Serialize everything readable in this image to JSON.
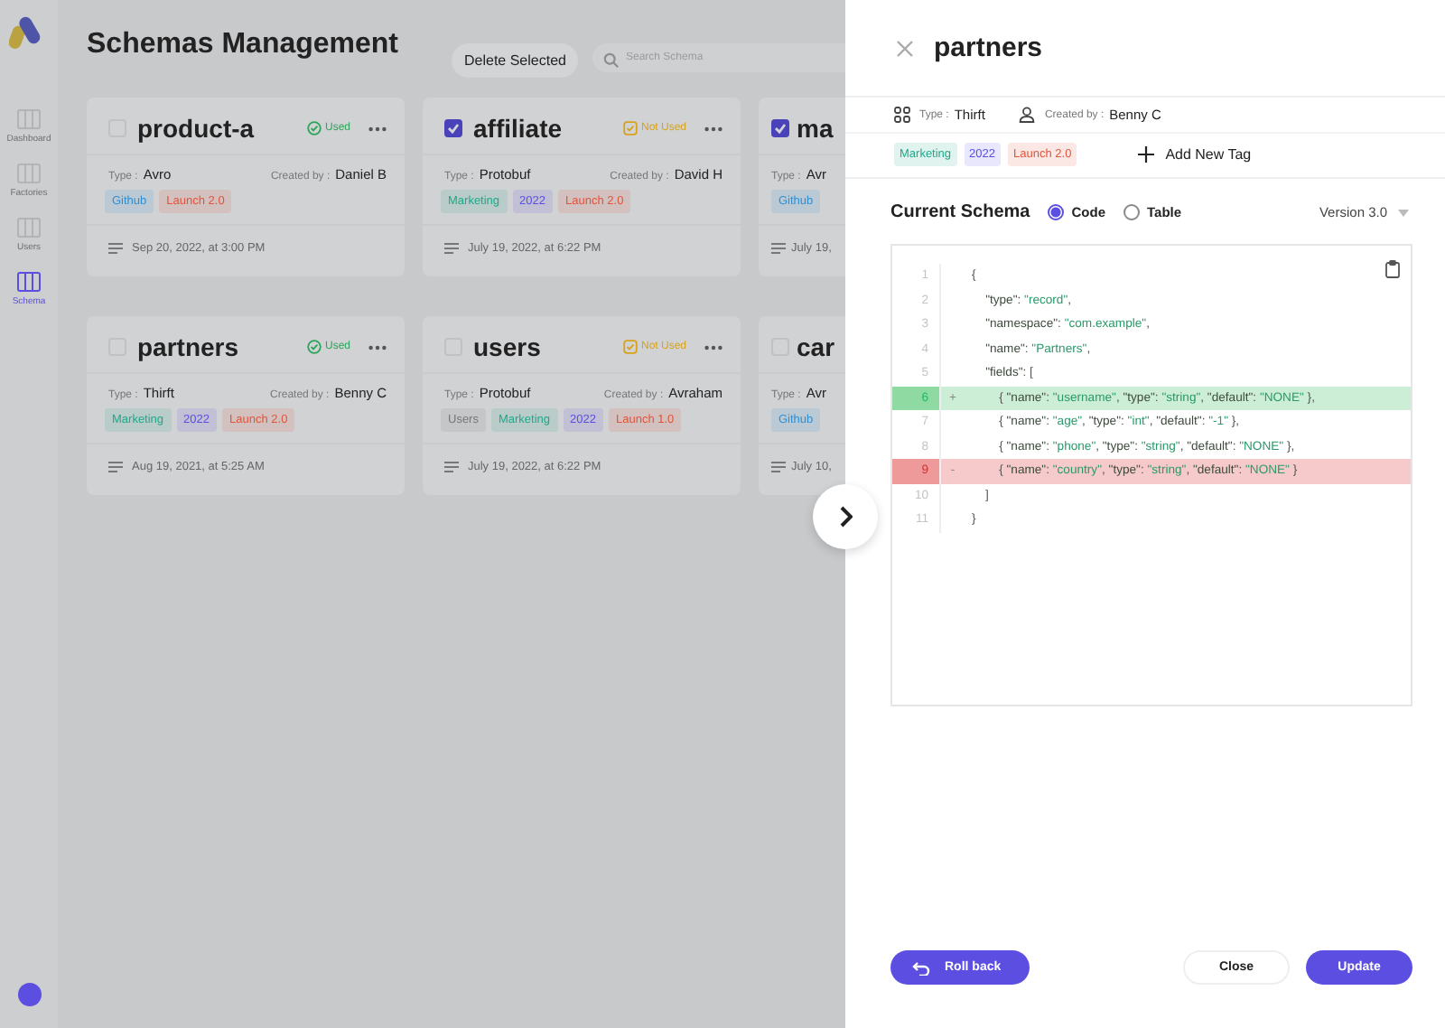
{
  "sidebar": {
    "items": [
      {
        "label": "Dashboard",
        "selected": false
      },
      {
        "label": "Factories",
        "selected": false
      },
      {
        "label": "Users",
        "selected": false
      },
      {
        "label": "Schema",
        "selected": true
      }
    ]
  },
  "page": {
    "title": "Schemas Management",
    "delete_button": "Delete Selected",
    "search": {
      "placeholder": "Search Schema"
    }
  },
  "cards": [
    {
      "title": "product-a",
      "checked": false,
      "status": {
        "label": "Used",
        "kind": "used"
      },
      "type_label": "Type :",
      "type": "Avro",
      "created_label": "Created by :",
      "created_by": "Daniel B",
      "tags": [
        {
          "label": "Github",
          "color": "#2b8fd6"
        },
        {
          "label": "Launch 2.0",
          "color": "#e0543c"
        }
      ],
      "date": "Sep 20, 2022, at 3:00 PM"
    },
    {
      "title": "affiliate",
      "checked": true,
      "status": {
        "label": "Not Used",
        "kind": "unused"
      },
      "type_label": "Type :",
      "type": "Protobuf",
      "created_label": "Created by :",
      "created_by": "David H",
      "tags": [
        {
          "label": "Marketing",
          "color": "#1fa88a"
        },
        {
          "label": "2022",
          "color": "#5b4ee0"
        },
        {
          "label": "Launch 2.0",
          "color": "#e0543c"
        }
      ],
      "date": "July 19, 2022, at 6:22 PM"
    },
    {
      "title": "ma",
      "checked": true,
      "type_label": "Type :",
      "type": "Avr",
      "tags": [
        {
          "label": "Github",
          "color": "#2b8fd6"
        }
      ],
      "date": "July 19,"
    },
    {
      "title": "partners",
      "checked": false,
      "status": {
        "label": "Used",
        "kind": "used"
      },
      "type_label": "Type :",
      "type": "Thirft",
      "created_label": "Created by :",
      "created_by": "Benny C",
      "tags": [
        {
          "label": "Marketing",
          "color": "#1fa88a"
        },
        {
          "label": "2022",
          "color": "#5b4ee0"
        },
        {
          "label": "Launch 2.0",
          "color": "#e0543c"
        }
      ],
      "date": "Aug 19, 2021, at 5:25 AM"
    },
    {
      "title": "users",
      "checked": false,
      "status": {
        "label": "Not Used",
        "kind": "unused"
      },
      "type_label": "Type :",
      "type": "Protobuf",
      "created_label": "Created by :",
      "created_by": "Avraham",
      "tags": [
        {
          "label": "Users",
          "color": "#777777"
        },
        {
          "label": "Marketing",
          "color": "#1fa88a"
        },
        {
          "label": "2022",
          "color": "#5b4ee0"
        },
        {
          "label": "Launch 1.0",
          "color": "#e0543c"
        }
      ],
      "date": "July 19, 2022, at 6:22 PM"
    },
    {
      "title": "car",
      "checked": false,
      "type_label": "Type :",
      "type": "Avr",
      "tags": [
        {
          "label": "Github",
          "color": "#2b8fd6"
        }
      ],
      "date": "July 10,"
    }
  ],
  "drawer": {
    "title": "partners",
    "type_label": "Type :",
    "type": "Thirft",
    "created_label": "Created by :",
    "created_by": "Benny C",
    "tags": [
      {
        "label": "Marketing",
        "color": "#1fa88a"
      },
      {
        "label": "2022",
        "color": "#5b4ee0"
      },
      {
        "label": "Launch 2.0",
        "color": "#e0543c"
      }
    ],
    "add_tag": "Add New Tag",
    "schema_heading": "Current Schema",
    "view_options": [
      {
        "label": "Code",
        "selected": true
      },
      {
        "label": "Table",
        "selected": false
      }
    ],
    "version": "Version 3.0",
    "code_lines": [
      {
        "number": "1",
        "kind": "normal",
        "text": "{"
      },
      {
        "number": "2",
        "kind": "normal",
        "text": "    \"type\": \"record\","
      },
      {
        "number": "3",
        "kind": "normal",
        "text": "    \"namespace\": \"com.example\","
      },
      {
        "number": "4",
        "kind": "normal",
        "text": "    \"name\": \"Partners\","
      },
      {
        "number": "5",
        "kind": "normal",
        "text": "    \"fields\": ["
      },
      {
        "number": "6",
        "marker": "+",
        "kind": "added",
        "text": "        { \"name\": \"username\", \"type\": \"string\", \"default\": \"NONE\" },"
      },
      {
        "number": "7",
        "kind": "normal",
        "text": "        { \"name\": \"age\", \"type\": \"int\", \"default\": \"-1\" },"
      },
      {
        "number": "8",
        "kind": "normal",
        "text": "        { \"name\": \"phone\", \"type\": \"string\", \"default\": \"NONE\" },"
      },
      {
        "number": "9",
        "marker": "-",
        "kind": "removed",
        "text": "        { \"name\": \"country\", \"type\": \"string\", \"default\": \"NONE\" }"
      },
      {
        "number": "10",
        "kind": "normal",
        "text": "    ]"
      },
      {
        "number": "11",
        "kind": "normal",
        "text": "}"
      }
    ],
    "rollback_button": "Roll back",
    "close_button": "Close",
    "update_button": "Update"
  }
}
